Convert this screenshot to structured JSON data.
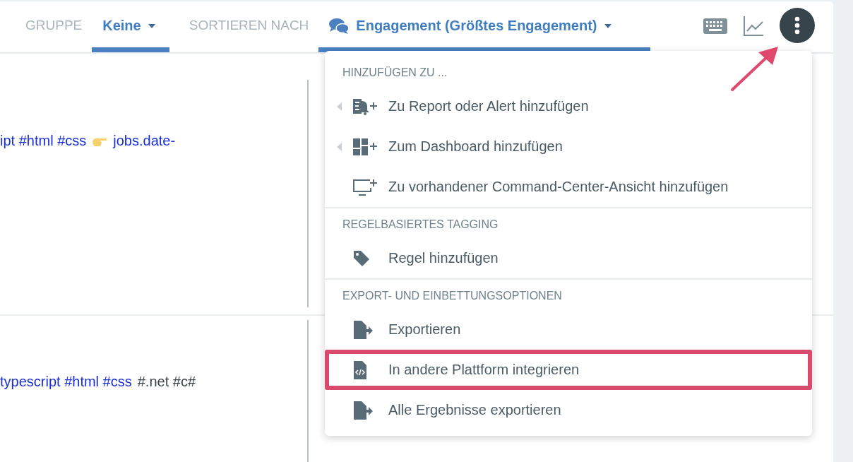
{
  "toolbar": {
    "group_label": "GRUPPE",
    "group_value": "Keine",
    "sort_label": "SORTIEREN NACH",
    "sort_value": "Engagement (Größtes Engagement)"
  },
  "posts": [
    {
      "segments": [
        {
          "kind": "link",
          "text": "ipt #html #css"
        },
        {
          "kind": "emoji"
        },
        {
          "kind": "link",
          "text": "jobs.date-"
        }
      ]
    },
    {
      "segments": [
        {
          "kind": "link",
          "text": "typescript #html #css"
        },
        {
          "kind": "plain",
          "text": "#.net #c#"
        }
      ]
    }
  ],
  "menu": {
    "sections": [
      {
        "header": "HINZUFÜGEN ZU ...",
        "items": [
          {
            "label": "Zu Report oder Alert hinzufügen",
            "kind": "bell-add",
            "has_submenu": true,
            "highlighted": false
          },
          {
            "label": "Zum Dashboard hinzufügen",
            "kind": "dashboard-add",
            "has_submenu": true,
            "highlighted": false
          },
          {
            "label": "Zu vorhandener Command-Center-Ansicht hinzufügen",
            "kind": "monitor-add",
            "has_submenu": false,
            "highlighted": false
          }
        ]
      },
      {
        "header": "REGELBASIERTES TAGGING",
        "items": [
          {
            "label": "Regel hinzufügen",
            "kind": "tag",
            "has_submenu": false,
            "highlighted": false
          }
        ]
      },
      {
        "header": "EXPORT- UND EINBETTUNGSOPTIONEN",
        "items": [
          {
            "label": "Exportieren",
            "kind": "file-export",
            "has_submenu": false,
            "highlighted": false
          },
          {
            "label": "In andere Plattform integrieren",
            "kind": "file-code",
            "has_submenu": false,
            "highlighted": true
          },
          {
            "label": "Alle Ergebnisse exportieren",
            "kind": "file-export",
            "has_submenu": false,
            "highlighted": false
          }
        ]
      }
    ]
  }
}
